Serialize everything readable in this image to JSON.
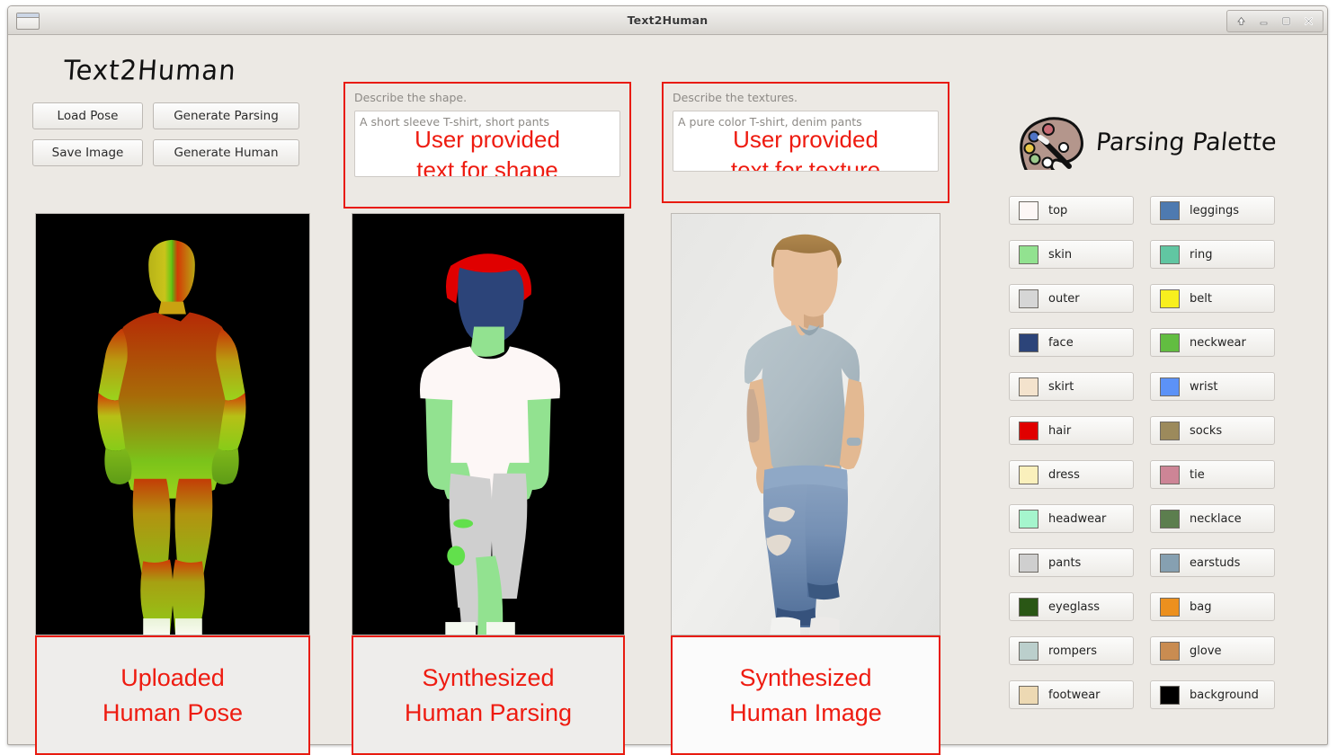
{
  "window": {
    "title": "Text2Human",
    "controls": [
      {
        "name": "rollup-button",
        "glyph": "↑"
      },
      {
        "name": "minimize-button",
        "glyph": "–"
      },
      {
        "name": "maximize-button",
        "glyph": "□"
      },
      {
        "name": "close-button",
        "glyph": "✕"
      }
    ]
  },
  "brand": {
    "title": "Text2Human"
  },
  "toolbar": {
    "buttons": [
      {
        "label": "Load Pose"
      },
      {
        "label": "Generate Parsing"
      },
      {
        "label": "Save Image"
      },
      {
        "label": "Generate Human"
      }
    ]
  },
  "prompts": {
    "shape": {
      "label": "Describe the shape.",
      "placeholder": "A short sleeve T-shirt, short pants",
      "value": "",
      "annotation": [
        "User provided",
        "text for shape"
      ]
    },
    "texture": {
      "label": "Describe the textures.",
      "placeholder": "A pure color T-shirt, denim pants",
      "value": "",
      "annotation": [
        "User provided",
        "text for texture"
      ]
    }
  },
  "panels": [
    {
      "name": "pose",
      "caption": [
        "Uploaded",
        "Human Pose"
      ]
    },
    {
      "name": "parsing",
      "caption": [
        "Synthesized",
        "Human Parsing"
      ]
    },
    {
      "name": "image",
      "caption": [
        "Synthesized",
        "Human Image"
      ]
    }
  ],
  "palette": {
    "title": "Parsing Palette",
    "icon": "palette-icon",
    "items": [
      {
        "label": "top",
        "color": "#fdf7f6"
      },
      {
        "label": "leggings",
        "color": "#4e7ab0"
      },
      {
        "label": "skin",
        "color": "#92e290"
      },
      {
        "label": "ring",
        "color": "#61c6a2"
      },
      {
        "label": "outer",
        "color": "#d6d6d6"
      },
      {
        "label": "belt",
        "color": "#f8ef1e"
      },
      {
        "label": "face",
        "color": "#2c4479"
      },
      {
        "label": "neckwear",
        "color": "#62bd41"
      },
      {
        "label": "skirt",
        "color": "#f4e3cd"
      },
      {
        "label": "wrist",
        "color": "#5c92f7"
      },
      {
        "label": "hair",
        "color": "#e00000"
      },
      {
        "label": "socks",
        "color": "#9c8a5c"
      },
      {
        "label": "dress",
        "color": "#faf0bc"
      },
      {
        "label": "tie",
        "color": "#cd8596"
      },
      {
        "label": "headwear",
        "color": "#a5f5cd"
      },
      {
        "label": "necklace",
        "color": "#5c7e4e"
      },
      {
        "label": "pants",
        "color": "#cfcfcf"
      },
      {
        "label": "earstuds",
        "color": "#86a0b1"
      },
      {
        "label": "eyeglass",
        "color": "#2a5715"
      },
      {
        "label": "bag",
        "color": "#ec901e"
      },
      {
        "label": "rompers",
        "color": "#bbcfcc"
      },
      {
        "label": "glove",
        "color": "#c98c51"
      },
      {
        "label": "footwear",
        "color": "#edd9b3"
      },
      {
        "label": "background",
        "color": "#000000"
      }
    ]
  },
  "colors": {
    "annotation_red": "#ee1b10",
    "window_bg": "#ece9e4",
    "panel_bg": "#000000"
  }
}
